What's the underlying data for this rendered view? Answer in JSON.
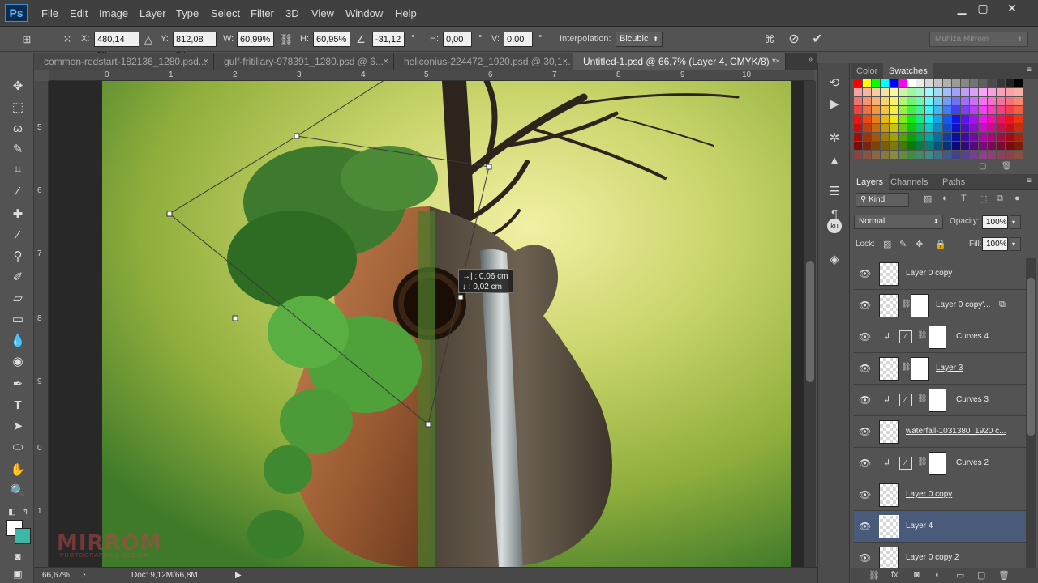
{
  "app": {
    "logo": "Ps",
    "menu": [
      "File",
      "Edit",
      "Image",
      "Layer",
      "Type",
      "Select",
      "Filter",
      "3D",
      "View",
      "Window",
      "Help"
    ],
    "window_controls": [
      "minimize-icon",
      "maximize-icon",
      "close-icon"
    ]
  },
  "options": {
    "x_label": "X:",
    "x_value": "480,14 px",
    "y_label": "Y:",
    "y_value": "812,08 px",
    "w_label": "W:",
    "w_value": "60,99%",
    "h_label": "H:",
    "h_value": "60,95%",
    "angle_value": "-31,12",
    "deg": "°",
    "hskew_label": "H:",
    "hskew_value": "0,00",
    "vskew_label": "V:",
    "vskew_value": "0,00",
    "interp_label": "Interpolation:",
    "interp_value": "Bicubic",
    "workspace": "Muhiza Mirrom"
  },
  "tabs": [
    {
      "label": "common-redstart-182136_1280.psd...",
      "active": false
    },
    {
      "label": "gulf-fritillary-978391_1280.psd @ 6...",
      "active": false
    },
    {
      "label": "heliconius-224472_1920.psd @ 30,1...",
      "active": false
    },
    {
      "label": "Untitled-1.psd @ 66,7% (Layer 4, CMYK/8) *",
      "active": true
    }
  ],
  "tab_close": "×",
  "ruler": {
    "top": [
      "0",
      "1",
      "2",
      "3",
      "4",
      "5",
      "6",
      "7",
      "8",
      "9",
      "10"
    ],
    "left": [
      "5",
      "6",
      "7",
      "8",
      "9",
      "0",
      "1"
    ]
  },
  "canvas": {
    "tooltip_line1": "→| : 0,06 cm",
    "tooltip_line2": "↓ : 0,02 cm",
    "watermark": "MIRROM",
    "watermark_sub": "PHOTOGRAPHY & DESIGN"
  },
  "status": {
    "zoom": "66,67%",
    "doc": "Doc: 9,12M/66,8M"
  },
  "color_panel": {
    "tabs": [
      "Color",
      "Swatches"
    ],
    "active_tab": "Swatches"
  },
  "layers_panel": {
    "tabs": [
      "Layers",
      "Channels",
      "Paths"
    ],
    "active_tab": "Layers",
    "kind_filter": "Kind",
    "blend_mode": "Normal",
    "opacity_label": "Opacity:",
    "opacity_value": "100%",
    "lock_label": "Lock:",
    "fill_label": "Fill:",
    "fill_value": "100%",
    "layers": [
      {
        "name": "Layer 0 copy",
        "type": "pixel",
        "selected": false
      },
      {
        "name": "Layer 0 copy'...",
        "type": "masked-smart",
        "selected": false
      },
      {
        "name": "Curves 4",
        "type": "adjustment",
        "selected": false
      },
      {
        "name": "Layer 3",
        "type": "masked",
        "selected": false
      },
      {
        "name": "Curves 3",
        "type": "adjustment",
        "selected": false
      },
      {
        "name": "waterfall-1031380_1920 c...",
        "type": "pixel",
        "selected": false
      },
      {
        "name": "Curves 2",
        "type": "adjustment",
        "selected": false
      },
      {
        "name": "Layer 0 copy",
        "type": "pixel",
        "selected": false
      },
      {
        "name": "Layer 4",
        "type": "pixel",
        "selected": true
      },
      {
        "name": "Layer 0 copy 2",
        "type": "pixel",
        "selected": false
      }
    ]
  }
}
